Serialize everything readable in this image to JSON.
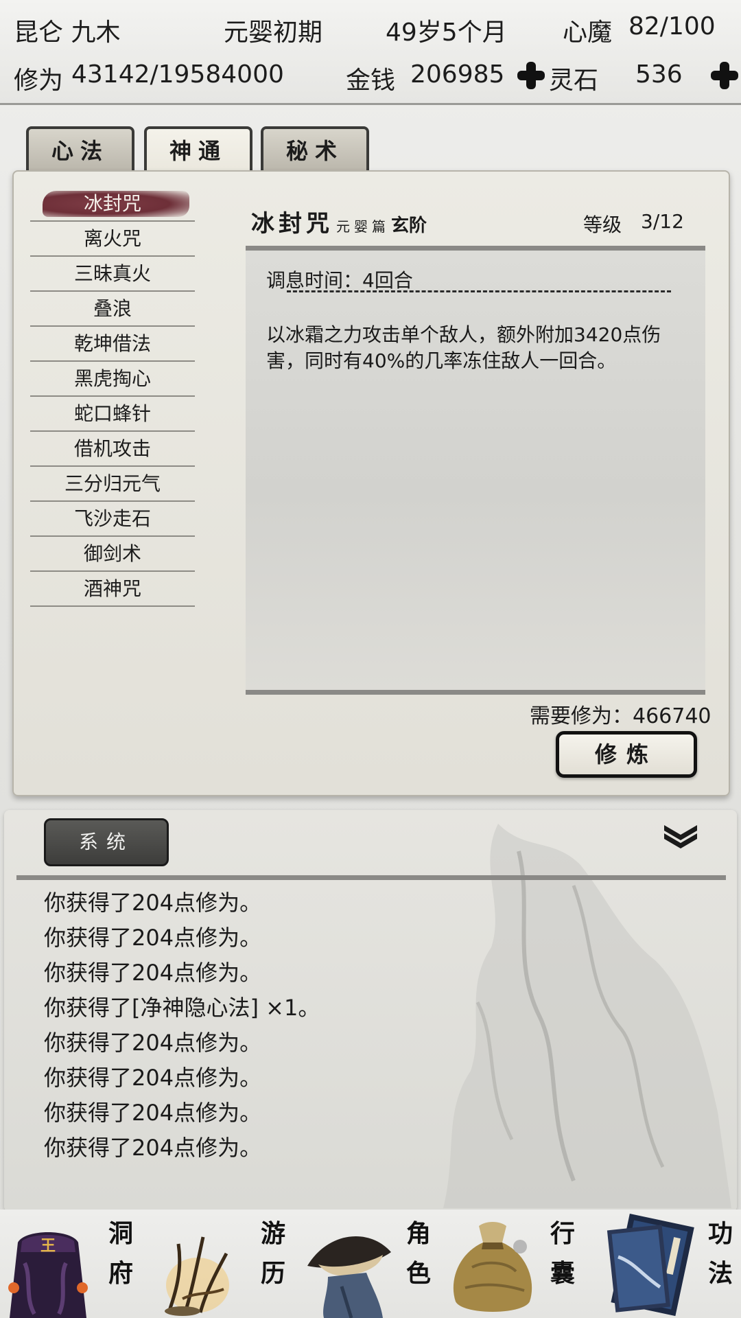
{
  "status": {
    "name": "昆仑 九木",
    "realm": "元婴初期",
    "age": "49岁5个月",
    "demon_label": "心魔",
    "demon_value": "82/100",
    "cultivation_label": "修为",
    "cultivation_value": "43142/19584000",
    "money_label": "金钱",
    "money_value": "206985",
    "spirit_stone_label": "灵石",
    "spirit_stone_value": "536"
  },
  "tabs": [
    {
      "label": "心法",
      "active": false
    },
    {
      "label": "神通",
      "active": true
    },
    {
      "label": "秘术",
      "active": false
    }
  ],
  "skills": [
    "冰封咒",
    "离火咒",
    "三昧真火",
    "叠浪",
    "乾坤借法",
    "黑虎掏心",
    "蛇口蜂针",
    "借机攻击",
    "三分归元气",
    "飞沙走石",
    "御剑术",
    "酒神咒"
  ],
  "selected_skill": {
    "name": "冰封咒",
    "book": "元婴篇",
    "rank": "玄阶",
    "level_label": "等级",
    "level_value": "3/12",
    "cooldown": "调息时间：4回合",
    "description": "以冰霜之力攻击单个敌人，额外附加3420点伤害，同时有40%的几率冻住敌人一回合。",
    "requirement": "需要修为：466740",
    "cultivate_button": "修炼"
  },
  "log": {
    "tab_label": "系统",
    "lines": [
      "你获得了204点修为。",
      "你获得了204点修为。",
      "你获得了204点修为。",
      "你获得了[净神隐心法] ×1。",
      "你获得了204点修为。",
      "你获得了204点修为。",
      "你获得了204点修为。",
      "你获得了204点修为。"
    ]
  },
  "bottom_nav": [
    {
      "label_top": "洞",
      "label_bottom": "府",
      "icon": "cave-dwelling-icon"
    },
    {
      "label_top": "游",
      "label_bottom": "历",
      "icon": "travel-icon"
    },
    {
      "label_top": "角",
      "label_bottom": "色",
      "icon": "character-icon"
    },
    {
      "label_top": "行",
      "label_bottom": "囊",
      "icon": "bag-icon"
    },
    {
      "label_top": "功",
      "label_bottom": "法",
      "icon": "skill-book-icon",
      "active": true
    }
  ],
  "icon_banner_text": "王"
}
